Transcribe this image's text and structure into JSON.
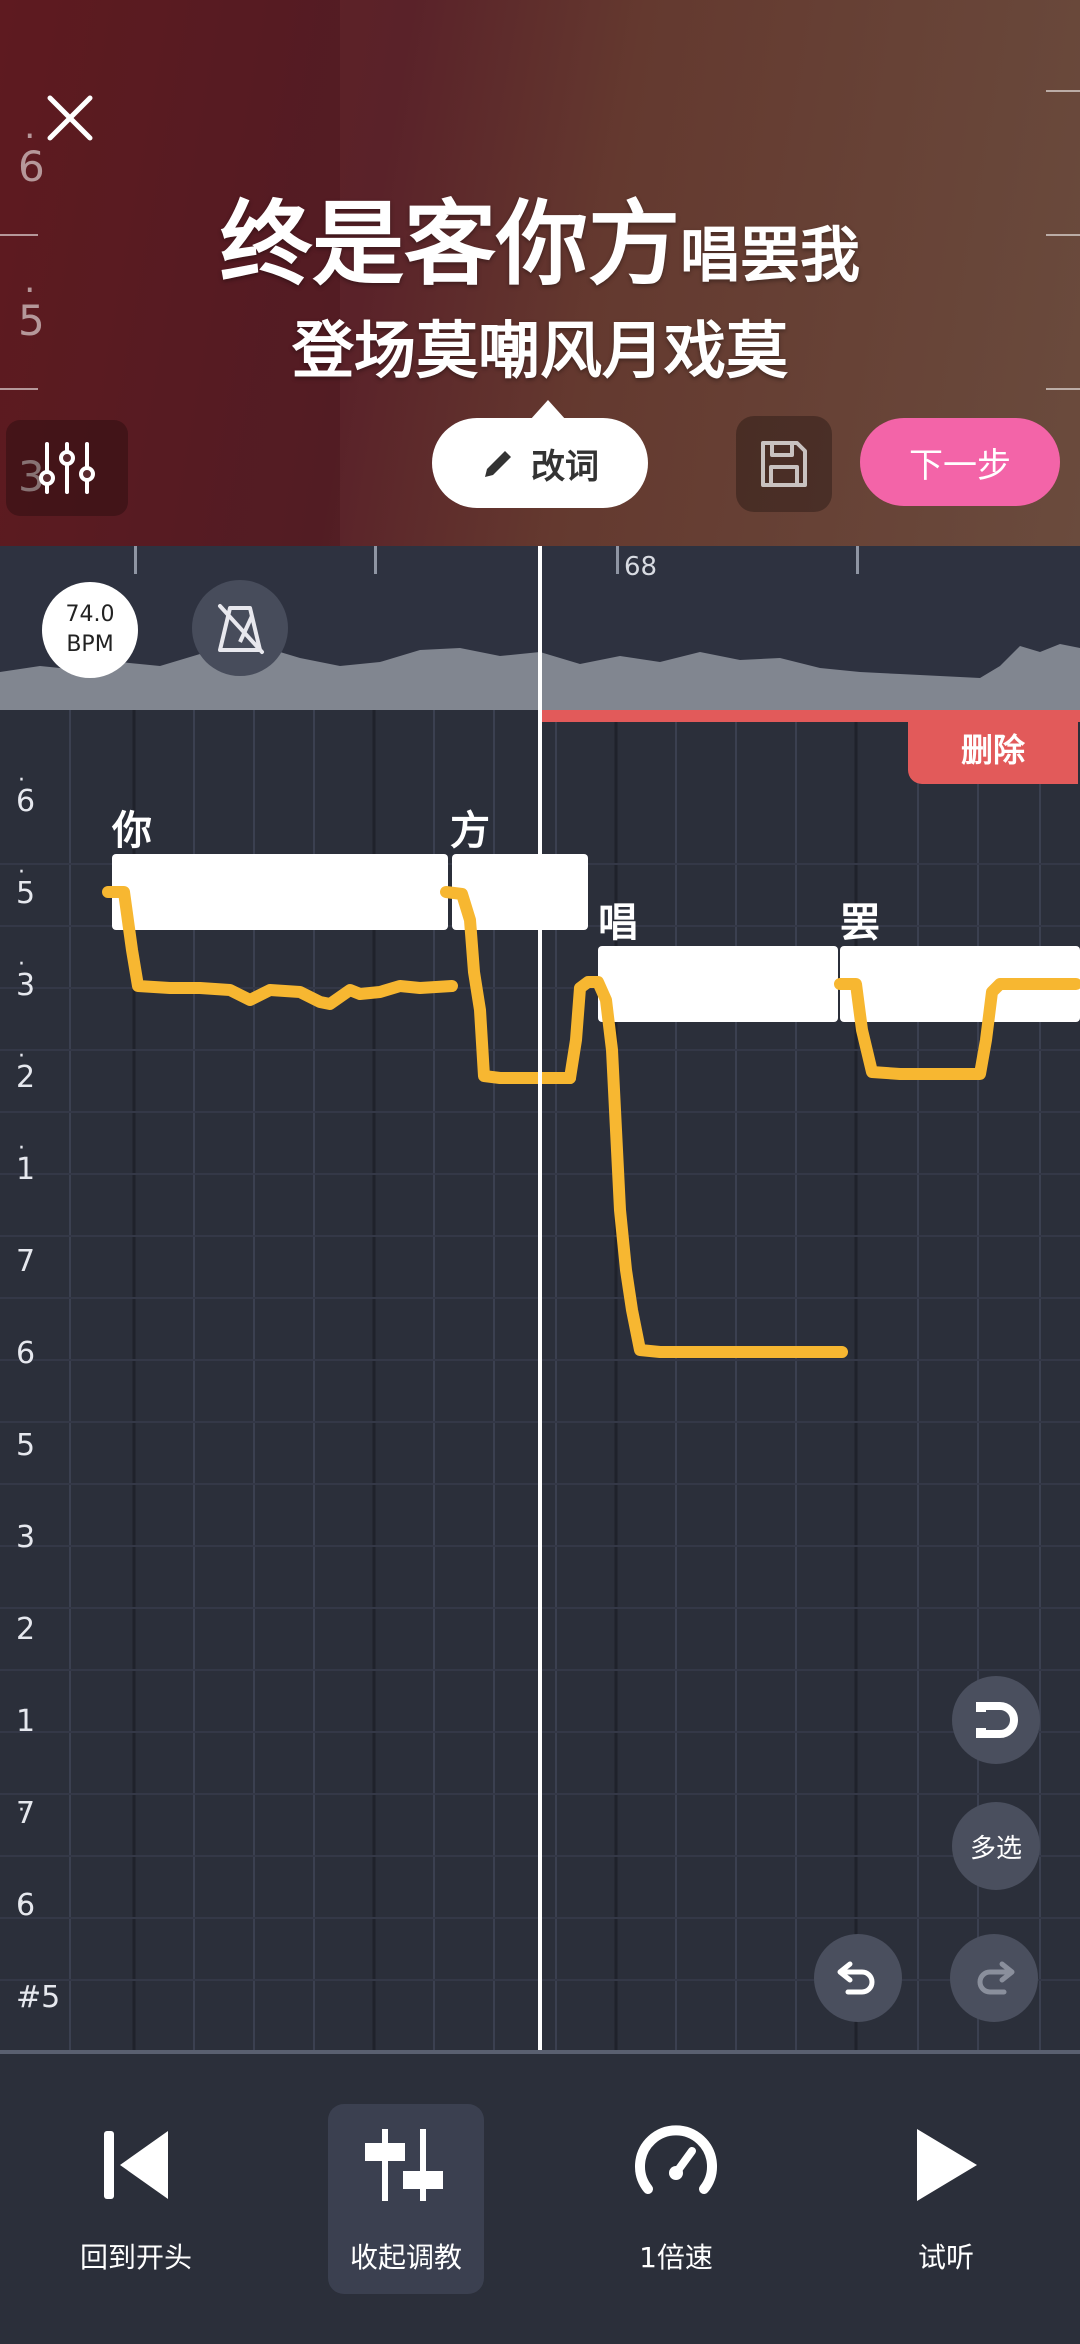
{
  "header": {
    "lyric_line_1_big": "终是客你方",
    "lyric_line_1_small": "唱罢我",
    "lyric_line_2": "登场莫嘲风月戏莫",
    "left_scale": [
      "6",
      "5",
      "3"
    ],
    "edit_lyrics_label": "改词",
    "next_label": "下一步"
  },
  "timeline": {
    "measure": "68",
    "bpm_value": "74.0",
    "bpm_unit": "BPM"
  },
  "roll": {
    "delete_label": "删除",
    "pitch_labels": [
      "6",
      "5",
      "3",
      "2",
      "1",
      "7",
      "6",
      "5",
      "3",
      "2",
      "1",
      "7",
      "6",
      "#5"
    ],
    "notes": [
      {
        "lyric": "你"
      },
      {
        "lyric": "方"
      },
      {
        "lyric": "唱"
      },
      {
        "lyric": "罢"
      }
    ],
    "multi_select_label": "多选"
  },
  "toolbar": {
    "rewind_label": "回到开头",
    "collapse_label": "收起调教",
    "speed_label": "1倍速",
    "play_label": "试听"
  },
  "colors": {
    "accent_pink": "#f364a8",
    "pitch_curve": "#f7b731",
    "delete_red": "#e25a5a",
    "background": "#2b2f3a"
  },
  "icons": [
    "close-icon",
    "mixer-sliders-icon",
    "pencil-icon",
    "save-icon",
    "metronome-muted-icon",
    "magnet-icon",
    "undo-icon",
    "redo-icon",
    "skip-to-start-icon",
    "tuning-sliders-icon",
    "speedometer-icon",
    "play-icon"
  ]
}
